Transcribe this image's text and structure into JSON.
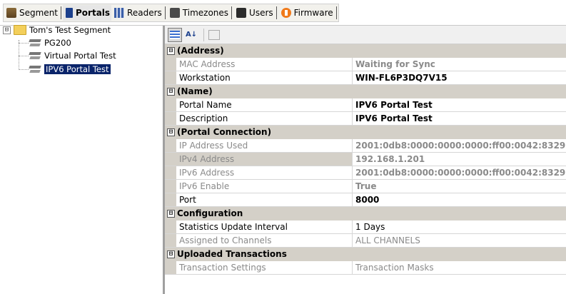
{
  "tabs": [
    {
      "label": "Segment",
      "icon": "segment-icon"
    },
    {
      "label": "Portals",
      "icon": "portal-icon"
    },
    {
      "label": "Readers",
      "icon": "readers-icon"
    },
    {
      "label": "Timezones",
      "icon": "timezones-icon"
    },
    {
      "label": "Users",
      "icon": "users-icon"
    },
    {
      "label": "Firmware",
      "icon": "firmware-icon"
    }
  ],
  "active_tab": "Portals",
  "tree": {
    "root": {
      "label": "Tom's Test Segment",
      "expander": "⊟"
    },
    "children": [
      {
        "label": "PG200"
      },
      {
        "label": "Virtual Portal Test"
      },
      {
        "label": "IPV6 Portal Test"
      }
    ]
  },
  "grid": {
    "categories": [
      {
        "label": "(Address)",
        "toggle": "⊟",
        "rows": [
          {
            "name": "MAC Address",
            "value": "Waiting for Sync",
            "readonly": true,
            "bold": true
          },
          {
            "name": "Workstation",
            "value": "WIN-FL6P3DQ7V15",
            "readonly": false,
            "bold": true
          }
        ]
      },
      {
        "label": "(Name)",
        "toggle": "⊟",
        "rows": [
          {
            "name": "Portal Name",
            "value": "IPV6 Portal Test",
            "readonly": false,
            "bold": true
          },
          {
            "name": "Description",
            "value": "IPV6 Portal Test",
            "readonly": false,
            "bold": true
          }
        ]
      },
      {
        "label": "(Portal Connection)",
        "toggle": "⊟",
        "rows": [
          {
            "name": "IP Address Used",
            "value": "2001:0db8:0000:0000:0000:ff00:0042:8329",
            "readonly": true,
            "bold": true
          },
          {
            "name": "IPv4 Address",
            "value": "192.168.1.201",
            "readonly": true,
            "bold": true,
            "selected": true
          },
          {
            "name": "IPv6 Address",
            "value": "2001:0db8:0000:0000:0000:ff00:0042:8329",
            "readonly": true,
            "bold": true
          },
          {
            "name": "IPv6 Enable",
            "value": "True",
            "readonly": true,
            "bold": true
          },
          {
            "name": "Port",
            "value": "8000",
            "readonly": false,
            "bold": true
          }
        ]
      },
      {
        "label": "Configuration",
        "toggle": "⊟",
        "rows": [
          {
            "name": "Statistics Update Interval",
            "value": "1 Days",
            "readonly": false,
            "bold": false
          },
          {
            "name": "Assigned to Channels",
            "value": "ALL CHANNELS",
            "readonly": true,
            "bold": false
          }
        ]
      },
      {
        "label": "Uploaded Transactions",
        "toggle": "⊟",
        "rows": [
          {
            "name": "Transaction Settings",
            "value": "Transaction Masks",
            "readonly": true,
            "bold": false
          }
        ]
      }
    ]
  }
}
